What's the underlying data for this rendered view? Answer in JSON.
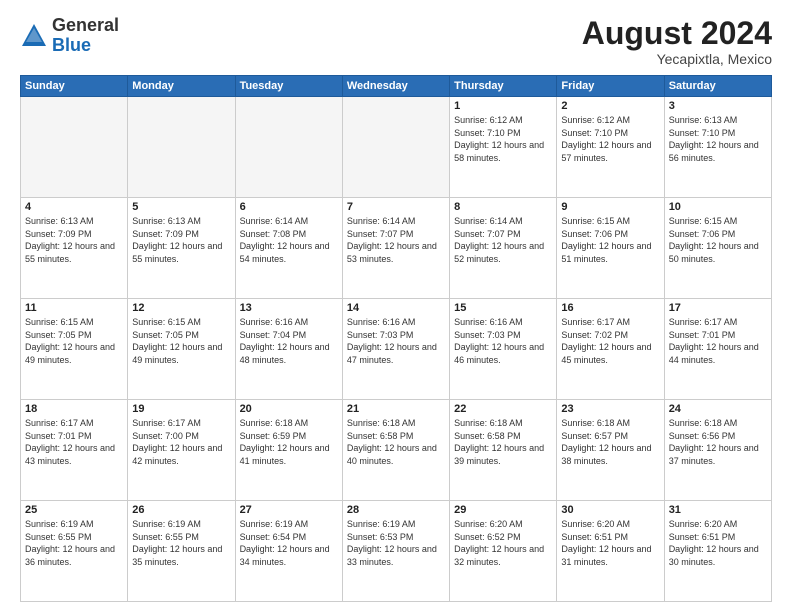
{
  "logo": {
    "general": "General",
    "blue": "Blue"
  },
  "header": {
    "month_year": "August 2024",
    "location": "Yecapixtla, Mexico"
  },
  "days_of_week": [
    "Sunday",
    "Monday",
    "Tuesday",
    "Wednesday",
    "Thursday",
    "Friday",
    "Saturday"
  ],
  "weeks": [
    [
      {
        "day": "",
        "empty": true
      },
      {
        "day": "",
        "empty": true
      },
      {
        "day": "",
        "empty": true
      },
      {
        "day": "",
        "empty": true
      },
      {
        "day": "1",
        "sunrise": "6:12 AM",
        "sunset": "7:10 PM",
        "daylight": "12 hours and 58 minutes."
      },
      {
        "day": "2",
        "sunrise": "6:12 AM",
        "sunset": "7:10 PM",
        "daylight": "12 hours and 57 minutes."
      },
      {
        "day": "3",
        "sunrise": "6:13 AM",
        "sunset": "7:10 PM",
        "daylight": "12 hours and 56 minutes."
      }
    ],
    [
      {
        "day": "4",
        "sunrise": "6:13 AM",
        "sunset": "7:09 PM",
        "daylight": "12 hours and 55 minutes."
      },
      {
        "day": "5",
        "sunrise": "6:13 AM",
        "sunset": "7:09 PM",
        "daylight": "12 hours and 55 minutes."
      },
      {
        "day": "6",
        "sunrise": "6:14 AM",
        "sunset": "7:08 PM",
        "daylight": "12 hours and 54 minutes."
      },
      {
        "day": "7",
        "sunrise": "6:14 AM",
        "sunset": "7:07 PM",
        "daylight": "12 hours and 53 minutes."
      },
      {
        "day": "8",
        "sunrise": "6:14 AM",
        "sunset": "7:07 PM",
        "daylight": "12 hours and 52 minutes."
      },
      {
        "day": "9",
        "sunrise": "6:15 AM",
        "sunset": "7:06 PM",
        "daylight": "12 hours and 51 minutes."
      },
      {
        "day": "10",
        "sunrise": "6:15 AM",
        "sunset": "7:06 PM",
        "daylight": "12 hours and 50 minutes."
      }
    ],
    [
      {
        "day": "11",
        "sunrise": "6:15 AM",
        "sunset": "7:05 PM",
        "daylight": "12 hours and 49 minutes."
      },
      {
        "day": "12",
        "sunrise": "6:15 AM",
        "sunset": "7:05 PM",
        "daylight": "12 hours and 49 minutes."
      },
      {
        "day": "13",
        "sunrise": "6:16 AM",
        "sunset": "7:04 PM",
        "daylight": "12 hours and 48 minutes."
      },
      {
        "day": "14",
        "sunrise": "6:16 AM",
        "sunset": "7:03 PM",
        "daylight": "12 hours and 47 minutes."
      },
      {
        "day": "15",
        "sunrise": "6:16 AM",
        "sunset": "7:03 PM",
        "daylight": "12 hours and 46 minutes."
      },
      {
        "day": "16",
        "sunrise": "6:17 AM",
        "sunset": "7:02 PM",
        "daylight": "12 hours and 45 minutes."
      },
      {
        "day": "17",
        "sunrise": "6:17 AM",
        "sunset": "7:01 PM",
        "daylight": "12 hours and 44 minutes."
      }
    ],
    [
      {
        "day": "18",
        "sunrise": "6:17 AM",
        "sunset": "7:01 PM",
        "daylight": "12 hours and 43 minutes."
      },
      {
        "day": "19",
        "sunrise": "6:17 AM",
        "sunset": "7:00 PM",
        "daylight": "12 hours and 42 minutes."
      },
      {
        "day": "20",
        "sunrise": "6:18 AM",
        "sunset": "6:59 PM",
        "daylight": "12 hours and 41 minutes."
      },
      {
        "day": "21",
        "sunrise": "6:18 AM",
        "sunset": "6:58 PM",
        "daylight": "12 hours and 40 minutes."
      },
      {
        "day": "22",
        "sunrise": "6:18 AM",
        "sunset": "6:58 PM",
        "daylight": "12 hours and 39 minutes."
      },
      {
        "day": "23",
        "sunrise": "6:18 AM",
        "sunset": "6:57 PM",
        "daylight": "12 hours and 38 minutes."
      },
      {
        "day": "24",
        "sunrise": "6:18 AM",
        "sunset": "6:56 PM",
        "daylight": "12 hours and 37 minutes."
      }
    ],
    [
      {
        "day": "25",
        "sunrise": "6:19 AM",
        "sunset": "6:55 PM",
        "daylight": "12 hours and 36 minutes."
      },
      {
        "day": "26",
        "sunrise": "6:19 AM",
        "sunset": "6:55 PM",
        "daylight": "12 hours and 35 minutes."
      },
      {
        "day": "27",
        "sunrise": "6:19 AM",
        "sunset": "6:54 PM",
        "daylight": "12 hours and 34 minutes."
      },
      {
        "day": "28",
        "sunrise": "6:19 AM",
        "sunset": "6:53 PM",
        "daylight": "12 hours and 33 minutes."
      },
      {
        "day": "29",
        "sunrise": "6:20 AM",
        "sunset": "6:52 PM",
        "daylight": "12 hours and 32 minutes."
      },
      {
        "day": "30",
        "sunrise": "6:20 AM",
        "sunset": "6:51 PM",
        "daylight": "12 hours and 31 minutes."
      },
      {
        "day": "31",
        "sunrise": "6:20 AM",
        "sunset": "6:51 PM",
        "daylight": "12 hours and 30 minutes."
      }
    ]
  ]
}
